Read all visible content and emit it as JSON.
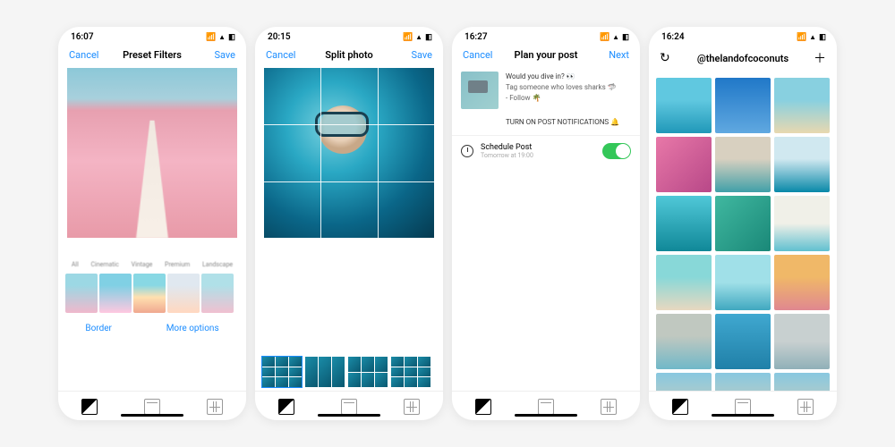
{
  "screens": {
    "filters": {
      "status_time": "16:07",
      "nav": {
        "left": "Cancel",
        "title": "Preset Filters",
        "right": "Save"
      },
      "filter_tabs": [
        "All",
        "Cinematic",
        "Vintage",
        "Premium",
        "Landscape"
      ],
      "actions": {
        "border": "Border",
        "more": "More options"
      }
    },
    "split": {
      "status_time": "20:15",
      "nav": {
        "left": "Cancel",
        "title": "Split photo",
        "right": "Save"
      }
    },
    "plan": {
      "status_time": "16:27",
      "nav": {
        "left": "Cancel",
        "title": "Plan your post",
        "right": "Next"
      },
      "caption_line1": "Would you dive in? 👀",
      "caption_line2": "Tag someone who loves sharks 🦈",
      "caption_line3": "- Follow 🌴",
      "notif": "TURN ON POST NOTIFICATIONS 🔔",
      "schedule": {
        "label": "Schedule Post",
        "sub": "Tomorrow at 19:00",
        "on": true
      }
    },
    "feed": {
      "status_time": "16:24",
      "nav": {
        "title": "@thelandofcoconuts"
      }
    }
  }
}
